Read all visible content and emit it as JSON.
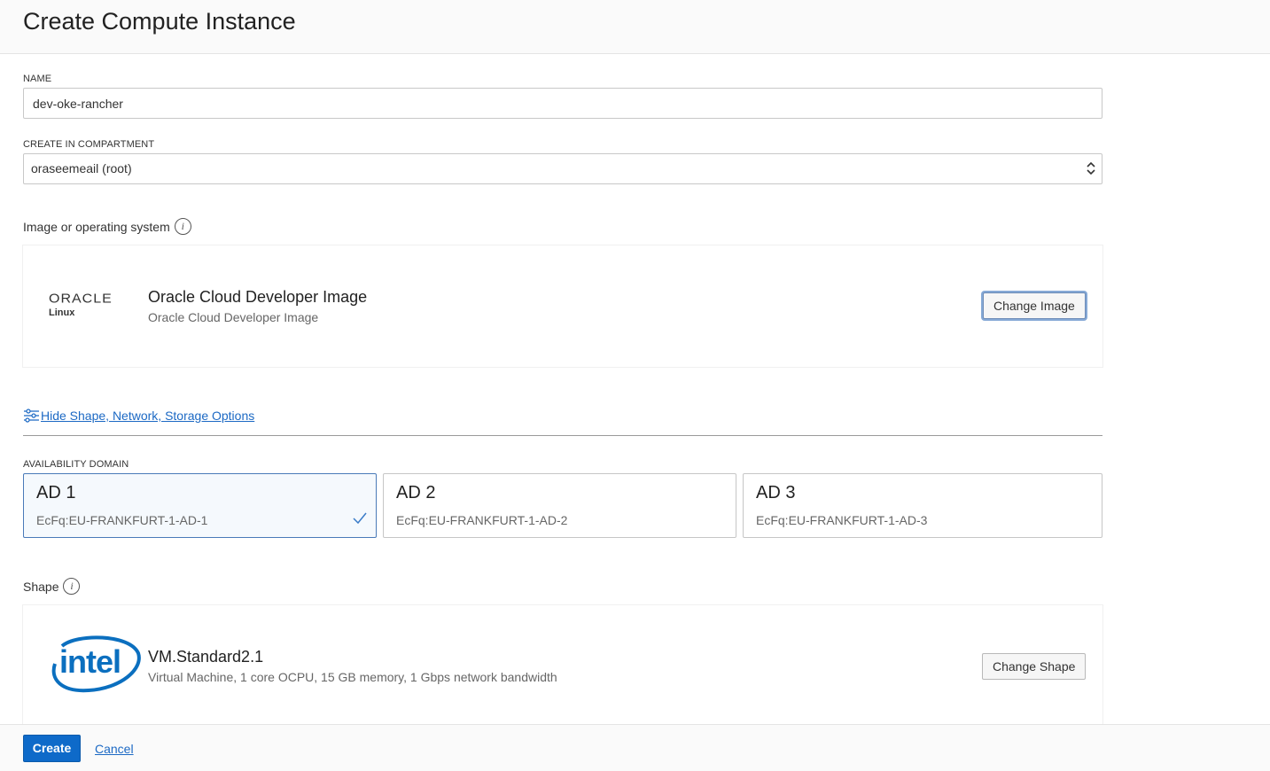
{
  "header": {
    "title": "Create Compute Instance"
  },
  "name_field": {
    "label": "NAME",
    "value": "dev-oke-rancher"
  },
  "compartment_field": {
    "label": "CREATE IN COMPARTMENT",
    "value": "oraseemeail (root)"
  },
  "image_section": {
    "label": "Image or operating system",
    "logo_brand": "ORACLE",
    "logo_sub": "Linux",
    "title": "Oracle Cloud Developer Image",
    "subtitle": "Oracle Cloud Developer Image",
    "button_label": "Change Image"
  },
  "options_toggle": {
    "label": "Hide Shape, Network, Storage Options"
  },
  "availability_domain": {
    "label": "AVAILABILITY DOMAIN",
    "options": [
      {
        "name": "AD 1",
        "id": "EcFq:EU-FRANKFURT-1-AD-1",
        "selected": true
      },
      {
        "name": "AD 2",
        "id": "EcFq:EU-FRANKFURT-1-AD-2",
        "selected": false
      },
      {
        "name": "AD 3",
        "id": "EcFq:EU-FRANKFURT-1-AD-3",
        "selected": false
      }
    ]
  },
  "shape_section": {
    "label": "Shape",
    "logo_text": "intel",
    "title": "VM.Standard2.1",
    "subtitle": "Virtual Machine, 1 core OCPU, 15 GB memory, 1 Gbps network bandwidth",
    "button_label": "Change Shape"
  },
  "footer": {
    "create_label": "Create",
    "cancel_label": "Cancel"
  },
  "colors": {
    "accent": "#0e6ac9",
    "link": "#1c69c4",
    "selected_border": "#4a7ab8",
    "intel_blue": "#0b6fbf"
  }
}
